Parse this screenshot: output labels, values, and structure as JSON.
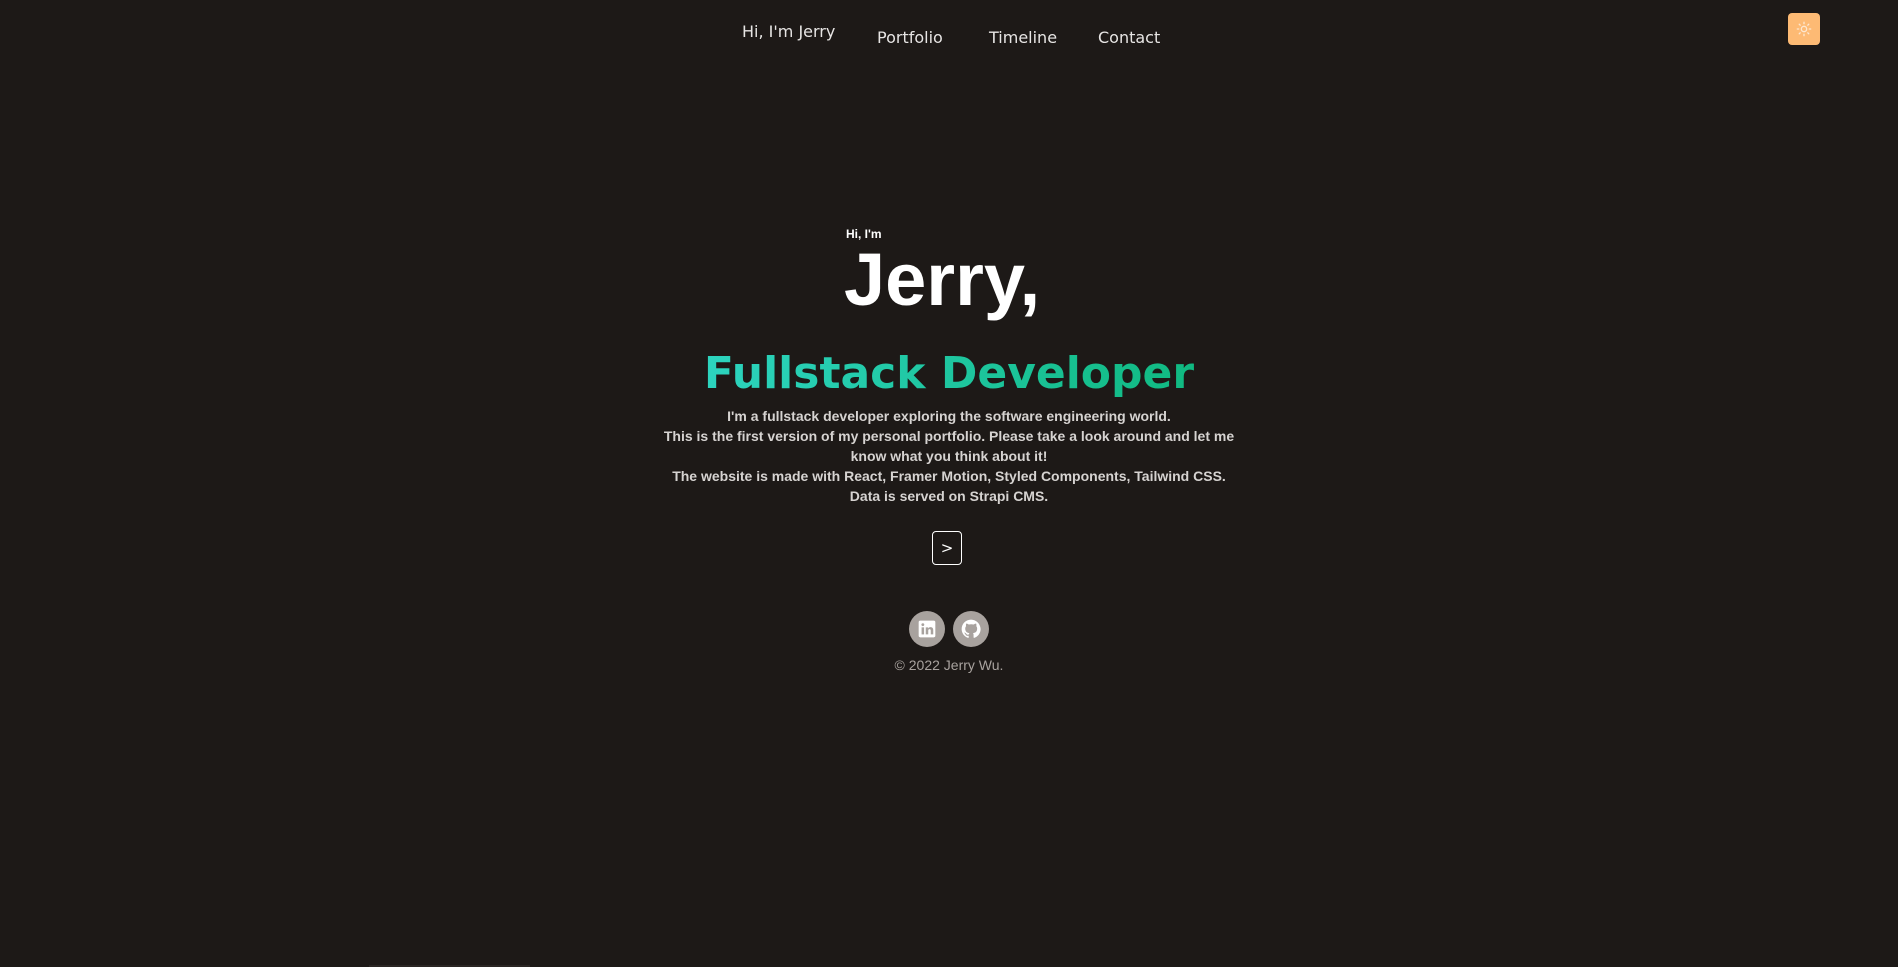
{
  "nav": {
    "brand": "Hi, I'm Jerry",
    "links": [
      "Portfolio",
      "Timeline",
      "Contact"
    ],
    "theme_toggle_icon": "sun-icon"
  },
  "hero": {
    "greeting": "Hi, I'm",
    "name": "Jerry,",
    "role": "Fullstack Developer",
    "description": [
      "I'm a fullstack developer exploring the software engineering world.",
      "This is the first version of my personal portfolio. Please take a look around and let me know what you think about it!",
      "The website is made with React, Framer Motion, Styled Components, Tailwind CSS.",
      "Data is served on Strapi CMS."
    ],
    "next_button": ">"
  },
  "footer": {
    "social": [
      {
        "icon": "linkedin-icon"
      },
      {
        "icon": "github-icon"
      }
    ],
    "copyright": "© 2022 Jerry Wu."
  },
  "colors": {
    "background": "#1d1917",
    "accent_gradient_start": "#2dd4bf",
    "accent_gradient_end": "#10b981",
    "theme_toggle": "#fdba74",
    "social_icon_bg": "#a8a29e"
  }
}
